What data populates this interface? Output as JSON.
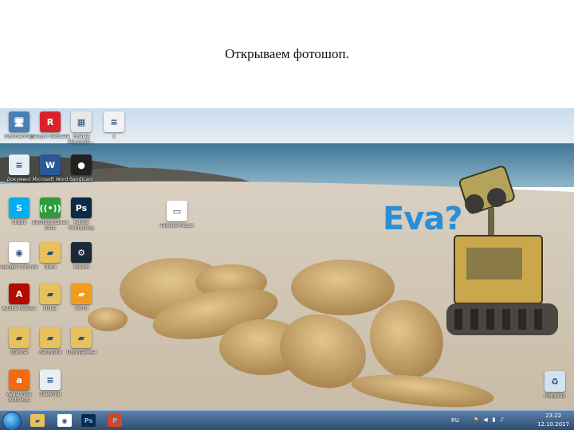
{
  "slide": {
    "title": "Открываем фотошоп."
  },
  "desktop": {
    "overlay_text": "Eva?",
    "icons": [
      {
        "label": "Компьютер",
        "glyph": "computer-icon",
        "color": "#4a7fb5",
        "symbol": "🖥"
      },
      {
        "label": "Запуск RedCafe",
        "glyph": "redcafe-icon",
        "color": "#d8232a",
        "symbol": "R"
      },
      {
        "label": "Новый Microsoft...",
        "glyph": "calendar-icon",
        "color": "#e8e8e8",
        "symbol": "▦"
      },
      {
        "label": "1",
        "glyph": "document-icon",
        "color": "#f2f2f2",
        "symbol": "≡"
      },
      {
        "label": "Документ",
        "glyph": "text-file-icon",
        "color": "#e8eef6",
        "symbol": "≡"
      },
      {
        "label": "Microsoft Word",
        "glyph": "word-icon",
        "color": "#2b5797",
        "symbol": "W"
      },
      {
        "label": "Bandicam",
        "glyph": "bandicam-icon",
        "color": "#222222",
        "symbol": "●"
      },
      {
        "label": "Skype",
        "glyph": "skype-icon",
        "color": "#00aff0",
        "symbol": "S"
      },
      {
        "label": "Беспроводная сеть",
        "glyph": "wifi-icon",
        "color": "#2e9c3a",
        "symbol": "((•))"
      },
      {
        "label": "Adobe Photoshop",
        "glyph": "photoshop-icon",
        "color": "#0b2a45",
        "symbol": "Ps"
      },
      {
        "label": "Презентация",
        "glyph": "presentation-file-icon",
        "color": "#ffffff",
        "symbol": "▭"
      },
      {
        "label": "Google Chrome",
        "glyph": "chrome-icon",
        "color": "#ffffff",
        "symbol": "◉"
      },
      {
        "label": "Dota",
        "glyph": "folder-icon",
        "color": "#e6c15c",
        "symbol": "▰"
      },
      {
        "label": "Steam",
        "glyph": "steam-icon",
        "color": "#1b2838",
        "symbol": "⚙"
      },
      {
        "label": "Adobe Reader",
        "glyph": "pdf-icon",
        "color": "#b30b00",
        "symbol": "A"
      },
      {
        "label": "Игры",
        "glyph": "folder-icon",
        "color": "#e6c15c",
        "symbol": "▰"
      },
      {
        "label": "Фото",
        "glyph": "image-folder-icon",
        "color": "#f39b1d",
        "symbol": "▰"
      },
      {
        "label": "Школа",
        "glyph": "folder-icon",
        "color": "#e6c15c",
        "symbol": "▰"
      },
      {
        "label": "Загрузки",
        "glyph": "folder-icon",
        "color": "#e6c15c",
        "symbol": "▰"
      },
      {
        "label": "Программы",
        "glyph": "folder-icon",
        "color": "#e6c15c",
        "symbol": "▰"
      },
      {
        "label": "Avast Free Antivirus",
        "glyph": "avast-icon",
        "color": "#f26c0d",
        "symbol": "a"
      },
      {
        "label": "Заметки",
        "glyph": "notes-icon",
        "color": "#e8eef6",
        "symbol": "≡"
      },
      {
        "label": "Корзина",
        "glyph": "recycle-bin-icon",
        "color": "#cfe3f2",
        "symbol": "♻"
      }
    ]
  },
  "taskbar": {
    "language": "RU",
    "time": "23:22",
    "date": "12.10.2017",
    "pinned": [
      {
        "name": "explorer",
        "glyph": "folder-icon",
        "color": "#e6c15c",
        "symbol": "▰"
      },
      {
        "name": "chrome",
        "glyph": "chrome-icon",
        "color": "#ffffff",
        "symbol": "◉"
      },
      {
        "name": "photoshop",
        "glyph": "photoshop-icon",
        "color": "#0b2a45",
        "symbol": "Ps"
      },
      {
        "name": "powerpoint",
        "glyph": "powerpoint-icon",
        "color": "#d24726",
        "symbol": "P"
      }
    ]
  }
}
